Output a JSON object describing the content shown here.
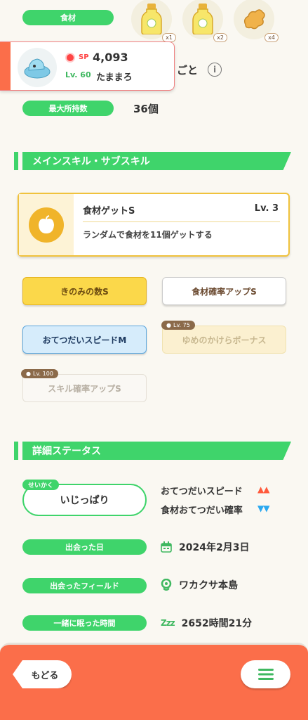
{
  "ingredients": {
    "label": "食材",
    "items": [
      {
        "icon": "oil-bottle-icon",
        "count": "x1"
      },
      {
        "icon": "oil-bottle-icon",
        "count": "x2"
      },
      {
        "icon": "ginger-icon",
        "count": "x4"
      }
    ]
  },
  "profile_popup": {
    "sp_label": "SP",
    "sp_value": "4,093",
    "level": "Lv. 60",
    "name": "たままろ"
  },
  "hidden_row_text": "ごと",
  "max_carry": {
    "label": "最大所持数",
    "value": "36個"
  },
  "skills_section": {
    "title": "メインスキル・サブスキル"
  },
  "main_skill": {
    "name": "食材ゲットS",
    "level": "Lv. 3",
    "description": "ランダムで食材を11個ゲットする"
  },
  "sub_skills": [
    {
      "label": "きのみの数S"
    },
    {
      "label": "食材確率アップS"
    },
    {
      "label": "おてつだいスピードM"
    },
    {
      "label": "ゆめのかけらボーナス",
      "lock": "Lv. 75"
    },
    {
      "label": "スキル確率アップS",
      "lock": "Lv. 100"
    }
  ],
  "details_section": {
    "title": "詳細ステータス"
  },
  "nature": {
    "tag": "せいかく",
    "value": "いじっぱり",
    "up_label": "おてつだいスピード",
    "down_label": "食材おてつだい確率",
    "up_color": "#ff5a3c",
    "down_color": "#2aa8f0"
  },
  "met_date": {
    "label": "出会った日",
    "value": "2024年2月3日"
  },
  "met_field": {
    "label": "出会ったフィールド",
    "value": "ワカクサ本島"
  },
  "sleep_time": {
    "label": "一緒に眠った時間",
    "value": "2652時間21分"
  },
  "footer": {
    "back_label": "もどる"
  },
  "colors": {
    "accent_green": "#3fd46b",
    "footer_orange": "#fb6e4a",
    "gold": "#f0c23c"
  }
}
